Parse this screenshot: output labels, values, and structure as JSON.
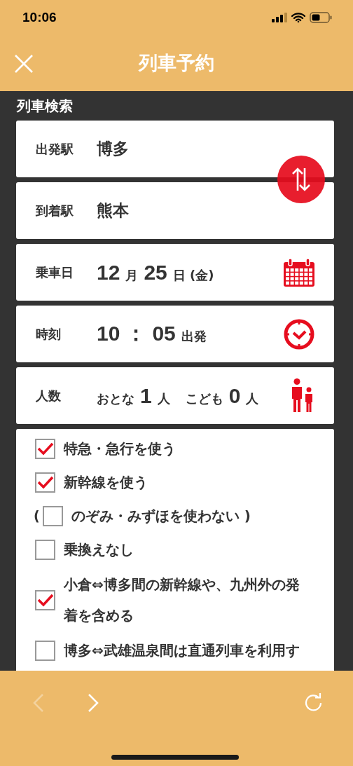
{
  "status_bar": {
    "time": "10:06"
  },
  "header": {
    "title": "列車予約"
  },
  "section_title": "列車検索",
  "fields": [
    {
      "kind": "station",
      "label": "出発駅",
      "value": "博多"
    },
    {
      "kind": "station",
      "label": "到着駅",
      "value": "熊本"
    },
    {
      "kind": "date",
      "label": "乗車日",
      "parts": [
        {
          "text": "12",
          "kind": "num"
        },
        {
          "text": "月",
          "kind": "unit"
        },
        {
          "text": "25",
          "kind": "num"
        },
        {
          "text": "日 (金)",
          "kind": "unit"
        }
      ]
    },
    {
      "kind": "time",
      "label": "時刻",
      "parts": [
        {
          "text": "10",
          "kind": "num"
        },
        {
          "text": "：",
          "kind": "num"
        },
        {
          "text": "05",
          "kind": "num"
        },
        {
          "text": "出発",
          "kind": "unit"
        }
      ]
    },
    {
      "kind": "people",
      "label": "人数",
      "parts": [
        {
          "text": "おとな",
          "kind": "unit"
        },
        {
          "text": "1",
          "kind": "num"
        },
        {
          "text": "人",
          "kind": "unit"
        },
        {
          "text": "こども",
          "kind": "gap"
        },
        {
          "text": "0",
          "kind": "num"
        },
        {
          "text": "人",
          "kind": "unit"
        }
      ]
    }
  ],
  "options": [
    {
      "kind": "plain",
      "label": "特急・急行を使う",
      "checked": true
    },
    {
      "kind": "plain",
      "label": "新幹線を使う",
      "checked": true
    },
    {
      "kind": "nested",
      "open": "(",
      "label": "のぞみ・みずほを使わない )",
      "checked": false
    },
    {
      "kind": "plain",
      "label": "乗換えなし",
      "checked": false
    },
    {
      "kind": "plain",
      "label": "小倉⇔博多間の新幹線や、九州外の発着を含める",
      "checked": true
    },
    {
      "kind": "plain",
      "label": "博多⇔武雄温泉間は直通列車を利用す",
      "checked": false
    }
  ],
  "nav": {
    "back": {
      "disabled": true
    },
    "forward": {
      "disabled": false
    }
  }
}
